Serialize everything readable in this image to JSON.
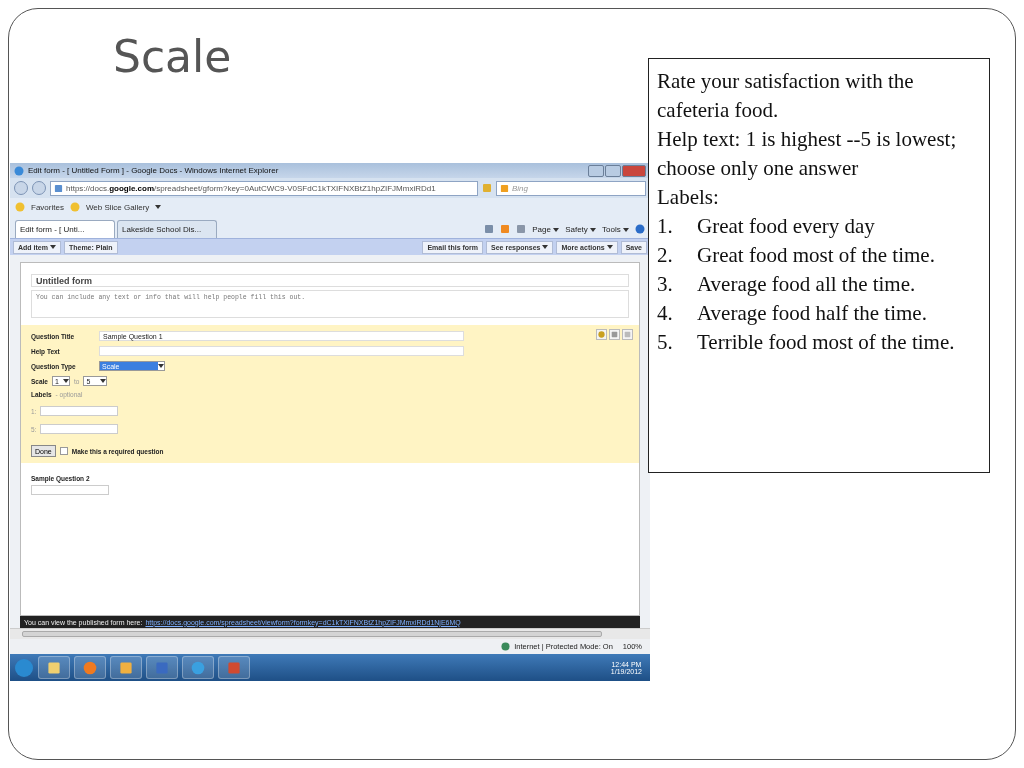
{
  "slide": {
    "title": "Scale"
  },
  "browser": {
    "title": "Edit form - [ Untitled Form ] - Google Docs - Windows Internet Explorer",
    "address_prefix": "https://docs.",
    "address_host": "google.com",
    "address_rest": "/spreadsheet/gform?key=0AutCWC9-V0SFdC1kTXIFNXBtZ1hpZIFJMmxiRDd1",
    "search_placeholder": "Bing",
    "favorites": "Favorites",
    "web_slice": "Web Slice Gallery",
    "tabs": [
      {
        "label": "Edit form - [ Unti...",
        "selected": true
      },
      {
        "label": "Lakeside School Dis...",
        "selected": false
      }
    ],
    "command_bar": [
      "Page",
      "Safety",
      "Tools"
    ]
  },
  "form_toolbar": {
    "left": [
      {
        "label": "Add item",
        "menu": true
      },
      {
        "label": "Theme: Plain",
        "menu": false
      }
    ],
    "right": [
      {
        "label": "Email this form",
        "menu": false
      },
      {
        "label": "See responses",
        "menu": true
      },
      {
        "label": "More actions",
        "menu": true
      },
      {
        "label": "Save",
        "menu": false
      }
    ]
  },
  "form": {
    "title": "Untitled form",
    "description": "You can include any text or info that will help people fill this out.",
    "question": {
      "fields": [
        {
          "label": "Question Title",
          "value": "Sample Question 1"
        },
        {
          "label": "Help Text"
        }
      ],
      "type_label": "Question Type",
      "type_value": "Scale",
      "scale_label": "Scale",
      "scale_from": "1",
      "scale_to_word": "to",
      "scale_to": "5",
      "labels_title": "Labels",
      "labels_hint": "- optional",
      "label_rows": [
        "1:",
        "5:"
      ],
      "done": "Done",
      "required": {
        "label": "Make this a required question",
        "checked": false
      }
    },
    "next_question": "Sample Question 2"
  },
  "published_bar": {
    "text": "You can view the published form here:",
    "link": "https://docs.google.com/spreadsheet/viewform?formkey=dC1kTXlFNXBtZ1hpZlFJMmxiRDd1NjE6MQ"
  },
  "status_bar": {
    "zone": "Internet | Protected Mode: On",
    "zoom": "100%"
  },
  "taskbar": {
    "time": "12:44 PM",
    "date": "1/19/2012"
  },
  "notes": {
    "lines": [
      "Rate your satisfaction with the cafeteria food.",
      "Help text: 1 is highest --5 is lowest; choose only one answer",
      "Labels:"
    ],
    "list": [
      {
        "number": "1.",
        "text": "Great food every day"
      },
      {
        "number": "2.",
        "text": "Great food most of the time."
      },
      {
        "number": "3.",
        "text": "Average food all the time."
      },
      {
        "number": "4.",
        "text": "Average food half the time."
      },
      {
        "number": "5.",
        "text": "Terrible food most of the time."
      }
    ]
  }
}
